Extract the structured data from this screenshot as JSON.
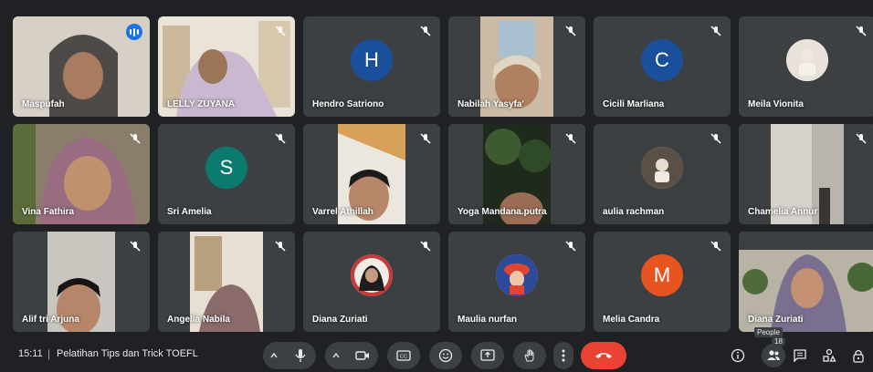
{
  "participants": [
    {
      "name": "Maspufah"
    },
    {
      "name": "LELLY ZUYANA"
    },
    {
      "name": "Hendro Satriono",
      "initial": "H",
      "avatar_color": "#1a4f9c"
    },
    {
      "name": "Nabilah Yasyfa'"
    },
    {
      "name": "Cicili Marliana",
      "initial": "C",
      "avatar_color": "#1a4f9c"
    },
    {
      "name": "Meila Vionita"
    },
    {
      "name": "Vina Fathira"
    },
    {
      "name": "Sri Amelia",
      "initial": "S",
      "avatar_color": "#0b7a6e"
    },
    {
      "name": "Varrel Athillah"
    },
    {
      "name": "Yoga Mandana.putra"
    },
    {
      "name": "aulia rachman"
    },
    {
      "name": "Chamelia Annur"
    },
    {
      "name": "Alif tri Arjuna"
    },
    {
      "name": "Angelia Nabila"
    },
    {
      "name": "Diana Zuriati"
    },
    {
      "name": "Maulia nurfan"
    },
    {
      "name": "Melia Candra",
      "initial": "M",
      "avatar_color": "#e8541f"
    },
    {
      "name": "Diana Zuriati"
    }
  ],
  "meeting": {
    "time": "15:11",
    "separator": "|",
    "title": "Pelatihan Tips dan Trick TOEFL"
  },
  "people_tooltip": "People",
  "people_count": "18",
  "icons": {
    "mic": "mic-icon",
    "camera": "camera-icon",
    "captions": "captions-icon",
    "emoji": "emoji-icon",
    "present": "present-icon",
    "hand": "raise-hand-icon",
    "more": "more-options-icon",
    "end": "end-call-icon",
    "info": "info-icon",
    "people": "people-icon",
    "chat": "chat-icon",
    "activities": "activities-icon",
    "lock": "host-controls-icon"
  }
}
